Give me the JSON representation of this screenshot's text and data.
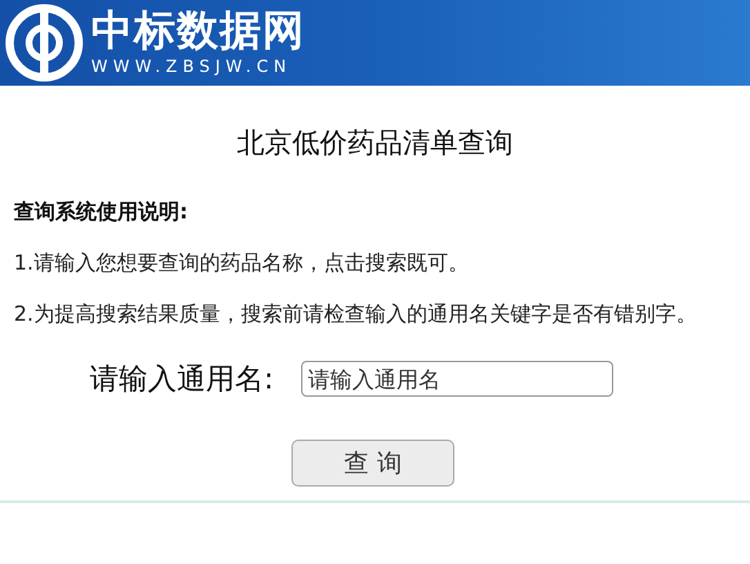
{
  "header": {
    "site_name": "中标数据网",
    "site_url": "WWW.ZBSJW.CN"
  },
  "title": "北京低价药品清单查询",
  "instructions": {
    "heading": "查询系统使用说明:",
    "items": [
      "1.请输入您想要查询的药品名称，点击搜索既可。",
      "2.为提高搜索结果质量，搜索前请检查输入的通用名关键字是否有错别字。"
    ]
  },
  "search": {
    "label": "请输入通用名:",
    "placeholder": "请输入通用名",
    "button": "查 询"
  }
}
